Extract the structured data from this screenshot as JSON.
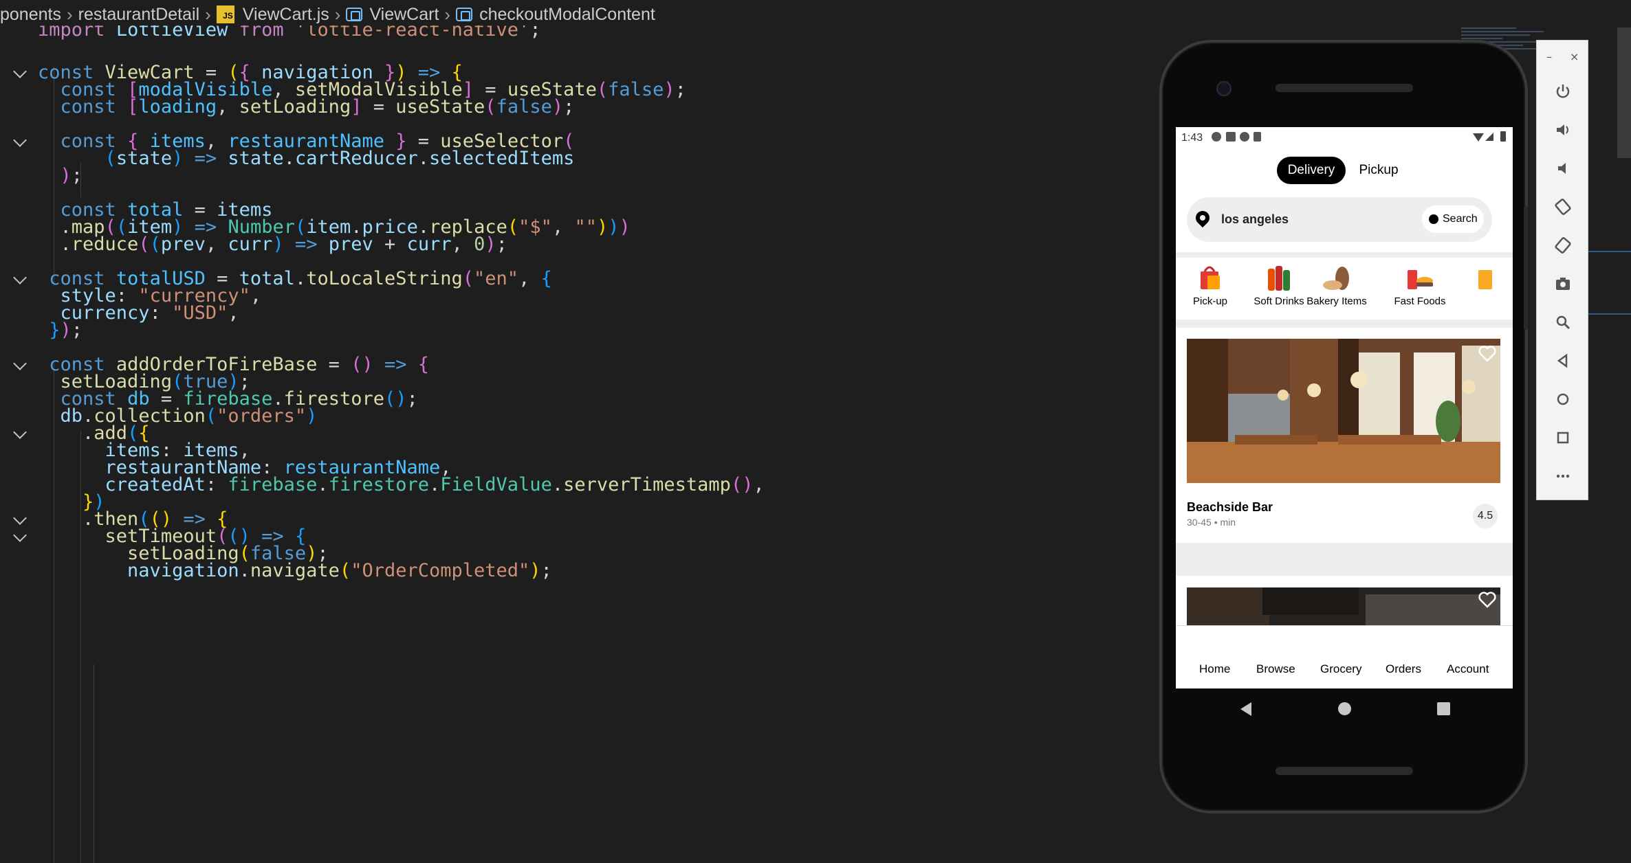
{
  "breadcrumb": {
    "parts": [
      "ponents",
      "restaurantDetail",
      "ViewCart.js",
      "ViewCart",
      "checkoutModalContent"
    ]
  },
  "code": {
    "line_import": "import LottieView from 'lottie-react-native';"
  },
  "emulator": {
    "status_time": "1:43",
    "tabs": {
      "delivery": "Delivery",
      "pickup": "Pickup"
    },
    "search": {
      "location": "los angeles",
      "button": "Search"
    },
    "categories": [
      "Pick-up",
      "Soft Drinks",
      "Bakery Items",
      "Fast Foods"
    ],
    "restaurant": {
      "name": "Beachside Bar",
      "eta": "30-45 • min",
      "rating": "4.5"
    },
    "bottom_tabs": [
      "Home",
      "Browse",
      "Grocery",
      "Orders",
      "Account"
    ],
    "toolbar": {
      "minimize": "–",
      "close": "×"
    }
  },
  "colors": {
    "editor_bg": "#1e1e1e",
    "keyword": "#569cd6",
    "function": "#dcdcaa",
    "variable": "#9cdcfe",
    "string": "#ce9178",
    "tab_active": "#000000"
  },
  "icons": [
    "js-file-icon",
    "symbol-icon",
    "pin-icon",
    "clock-icon",
    "heart-icon",
    "power-icon",
    "volume-up-icon",
    "volume-down-icon",
    "rotate-left-icon",
    "rotate-right-icon",
    "camera-icon",
    "zoom-icon",
    "back-icon",
    "home-icon",
    "overview-icon",
    "more-icon"
  ]
}
